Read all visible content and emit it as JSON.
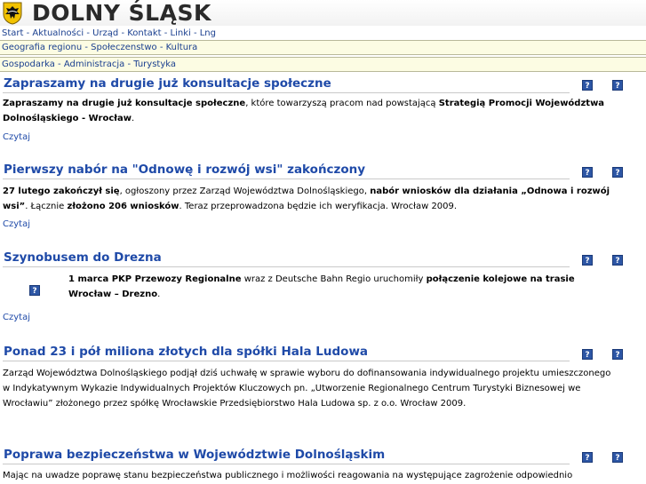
{
  "header": {
    "title": "DOLNY ŚLĄSK",
    "crest_icon": "eagle-crest-icon"
  },
  "topnav": [
    "Start",
    "Aktualności",
    "Urząd",
    "Kontakt",
    "Linki",
    "Lng"
  ],
  "menu1": [
    "Geografia regionu",
    "Społeczenstwo",
    "Kultura"
  ],
  "menu2": [
    "Gospodarka",
    "Administracja",
    "Turystyka"
  ],
  "separator": " - ",
  "read_label": "Czytaj",
  "help_glyph": "?",
  "articles": [
    {
      "title": "Zapraszamy na drugie już konsultacje społeczne",
      "body": [
        {
          "b": "Zapraszamy na drugie już konsultacje społeczne"
        },
        {
          "t": ", które towarzyszą pracom nad powstającą "
        },
        {
          "b": "Strategią Promocji Województwa Dolnośląskiego - Wrocław"
        },
        {
          "t": "."
        }
      ]
    },
    {
      "title": "Pierwszy nabór na \"Odnowę i rozwój wsi\" zakończony",
      "body": [
        {
          "b": "27 lutego zakończył się"
        },
        {
          "t": ", ogłoszony przez Zarząd Województwa Dolnośląskiego, "
        },
        {
          "b": "nabór wniosków dla działania „Odnowa i rozwój wsi”"
        },
        {
          "t": ". Łącznie "
        },
        {
          "b": "złożono 206 wniosków"
        },
        {
          "t": ". Teraz  przeprowadzona będzie ich weryfikacja. Wrocław 2009."
        }
      ]
    },
    {
      "title": "Szynobusem do Drezna",
      "body": [
        {
          "b": "1 marca PKP Przewozy Regionalne"
        },
        {
          "t": " wraz z Deutsche Bahn Regio uruchomiły "
        },
        {
          "b": "połączenie kolejowe na trasie Wrocław – Drezno"
        },
        {
          "t": "."
        }
      ]
    },
    {
      "title": "Ponad 23 i pół miliona złotych dla spółki Hala Ludowa",
      "body": [
        {
          "t": "Zarząd Województwa Dolnośląskiego podjął dziś uchwałę w sprawie wyboru do dofinansowania indywidualnego projektu umieszczonego w Indykatywnym Wykazie Indywidualnych  Projektów Kluczowych pn. „Utworzenie Regionalnego Centrum Turystyki Biznesowej we Wrocławiu” złożonego przez spółkę Wrocławskie Przedsiębiorstwo Hala Ludowa sp. z o.o. Wrocław 2009."
        }
      ]
    },
    {
      "title": "Poprawa bezpieczeństwa w Województwie Dolnośląskim",
      "body": [
        {
          "t": "Mając na uwadze poprawę stanu bezpieczeństwa publicznego i możliwości reagowania na występujące zagrożenie odpowiednio"
        }
      ]
    }
  ]
}
